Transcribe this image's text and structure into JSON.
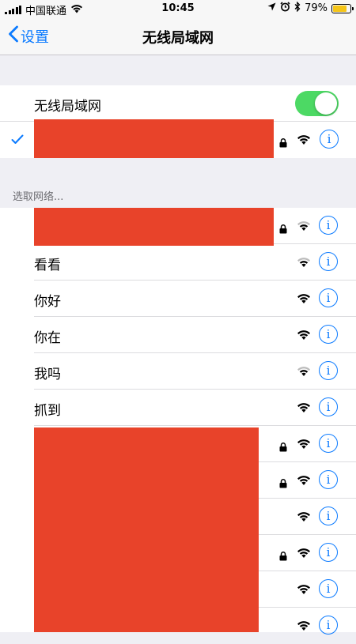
{
  "status_bar": {
    "carrier": "中国联通",
    "time": "10:45",
    "battery": "79%",
    "battery_level": 0.79
  },
  "nav": {
    "back_label": "设置",
    "title": "无线局域网"
  },
  "wifi_toggle": {
    "label": "无线局域网",
    "on": true
  },
  "section_header": "选取网络...",
  "networks": [
    {
      "name": "看看"
    },
    {
      "name": "你好"
    },
    {
      "name": "你在"
    },
    {
      "name": "我吗"
    },
    {
      "name": "抓到"
    }
  ],
  "colors": {
    "accent": "#0a7aff",
    "toggle_on": "#4cd964",
    "redaction": "#e8432a"
  }
}
